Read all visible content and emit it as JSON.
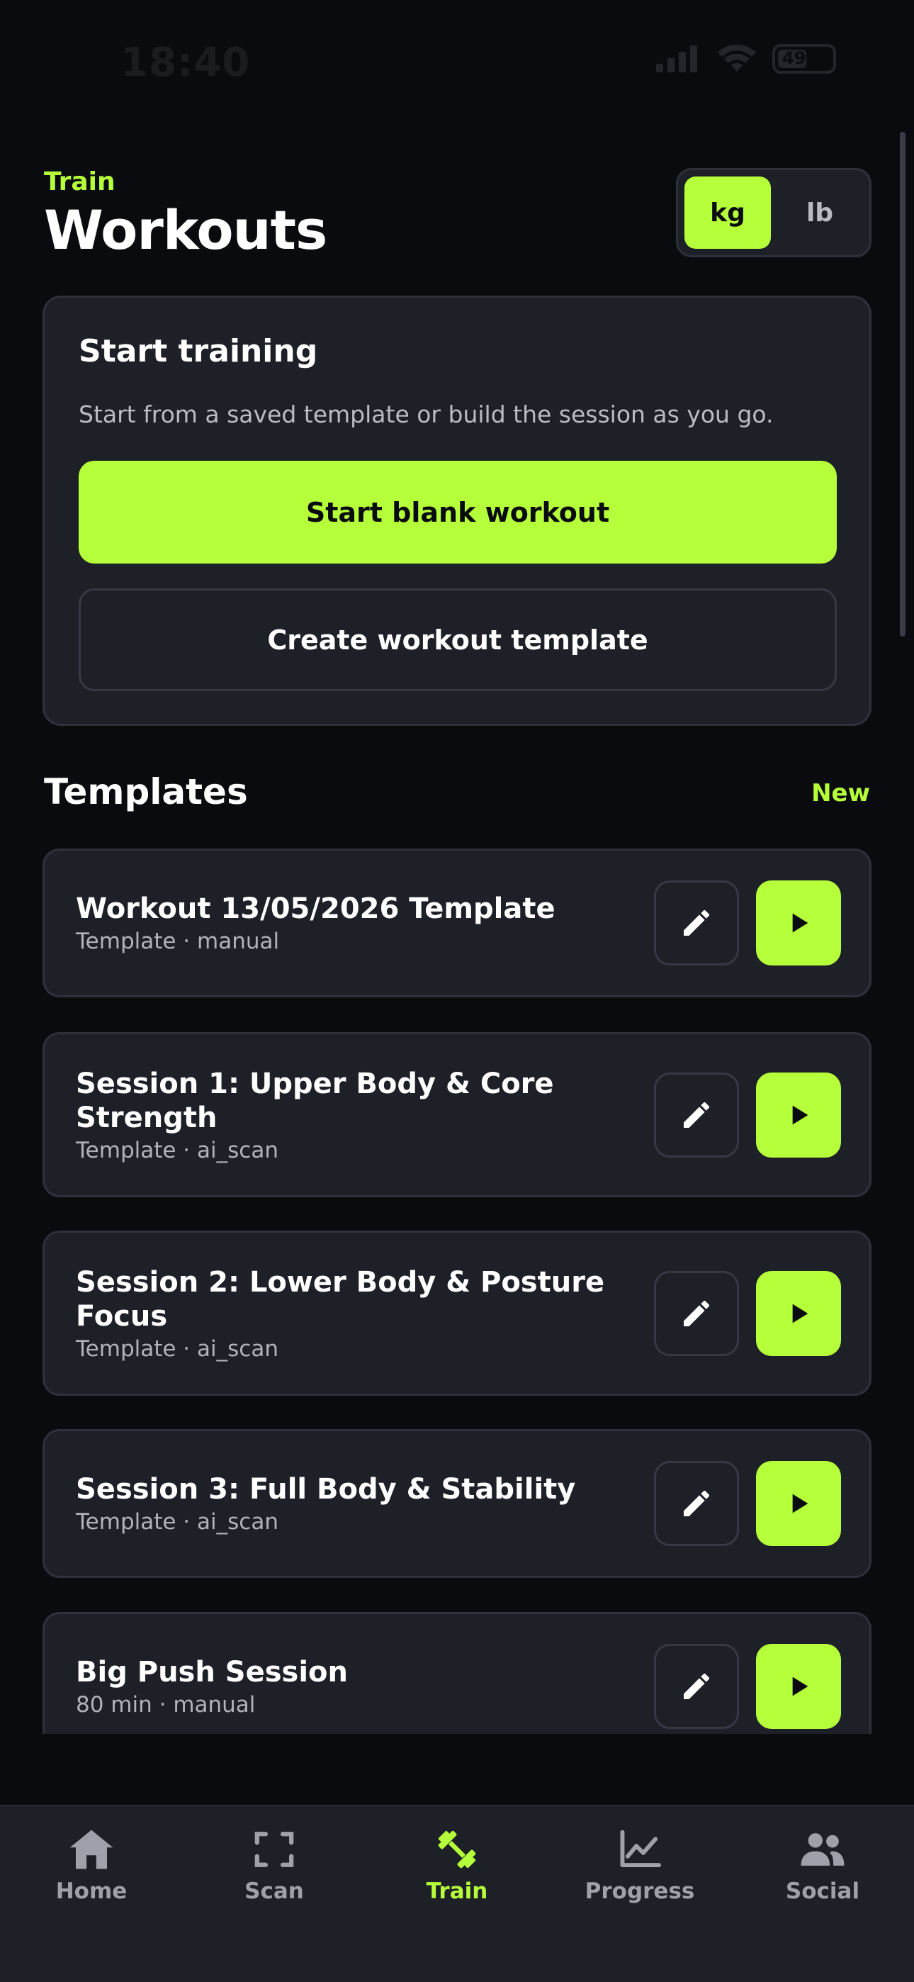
{
  "status_bar": {
    "time": "18:40",
    "battery": "49"
  },
  "header": {
    "eyebrow": "Train",
    "title": "Workouts"
  },
  "unit_toggle": {
    "options": [
      {
        "label": "kg",
        "active": true
      },
      {
        "label": "lb",
        "active": false
      }
    ]
  },
  "start_card": {
    "title": "Start training",
    "description": "Start from a saved template or build the session as you go.",
    "primary_label": "Start blank workout",
    "secondary_label": "Create workout template"
  },
  "templates": {
    "title": "Templates",
    "new_label": "New",
    "items": [
      {
        "title": "Workout 13/05/2026 Template",
        "subtitle": "Template · manual"
      },
      {
        "title": "Session 1: Upper Body & Core Strength",
        "subtitle": "Template · ai_scan"
      },
      {
        "title": "Session 2: Lower Body & Posture Focus",
        "subtitle": "Template · ai_scan"
      },
      {
        "title": "Session 3: Full Body & Stability",
        "subtitle": "Template · ai_scan"
      },
      {
        "title": "Big Push Session",
        "subtitle": "80 min · manual"
      }
    ]
  },
  "tab_bar": {
    "items": [
      {
        "label": "Home",
        "icon": "home-icon",
        "active": false
      },
      {
        "label": "Scan",
        "icon": "scan-icon",
        "active": false
      },
      {
        "label": "Train",
        "icon": "dumbbell-icon",
        "active": true
      },
      {
        "label": "Progress",
        "icon": "chart-icon",
        "active": false
      },
      {
        "label": "Social",
        "icon": "people-icon",
        "active": false
      }
    ]
  },
  "colors": {
    "accent": "#b6ff3b",
    "background": "#0a0b0f",
    "card": "#1e2028",
    "border": "#2e313a",
    "muted_text": "#b0b3bc"
  }
}
